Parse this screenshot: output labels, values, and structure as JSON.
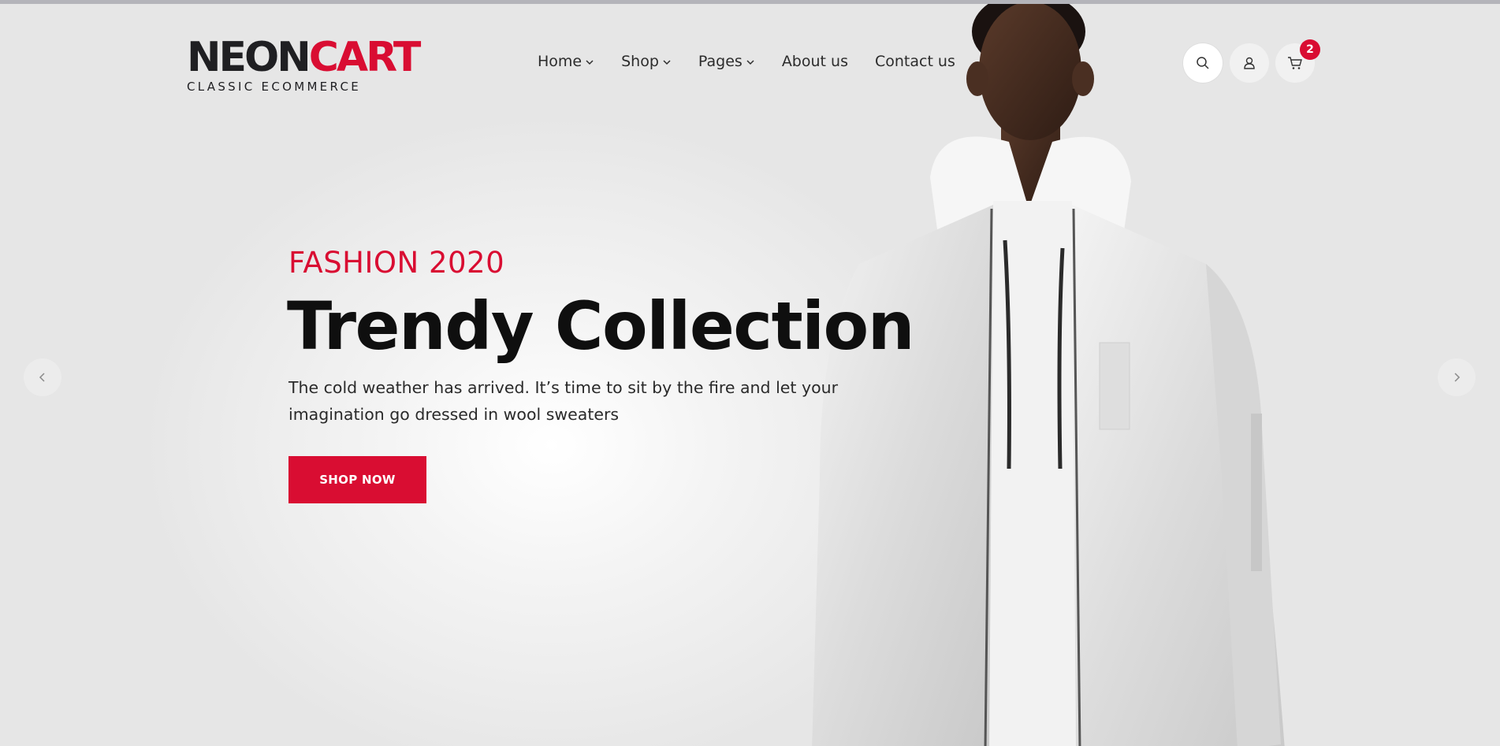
{
  "logo": {
    "part1": "NEON",
    "part2": "CART",
    "tagline": "CLASSIC ECOMMERCE"
  },
  "nav": {
    "items": [
      {
        "label": "Home",
        "has_dropdown": true
      },
      {
        "label": "Shop",
        "has_dropdown": true
      },
      {
        "label": "Pages",
        "has_dropdown": true
      },
      {
        "label": "About us",
        "has_dropdown": false
      },
      {
        "label": "Contact us",
        "has_dropdown": false
      }
    ]
  },
  "header_icons": {
    "search": "search-icon",
    "account": "user-icon",
    "cart": "cart-icon",
    "cart_count": "2"
  },
  "hero": {
    "subtitle": "FASHION 2020",
    "title": "Trendy Collection",
    "description": "The cold weather has arrived. It’s time to sit by the fire and let your imagination go dressed in wool sweaters",
    "button": "SHOP NOW"
  },
  "slider": {
    "prev_icon": "chevron-left-icon",
    "next_icon": "chevron-right-icon"
  },
  "colors": {
    "accent": "#d90d32",
    "dark": "#1f1f22",
    "background": "#e9e9e9"
  }
}
